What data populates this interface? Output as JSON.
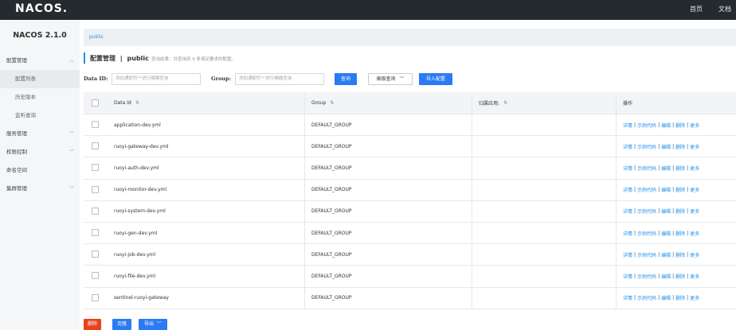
{
  "header": {
    "logo": "NACOS.",
    "nav": [
      "首页",
      "文档"
    ]
  },
  "sidebar": {
    "version": "NACOS 2.1.0",
    "items": [
      {
        "label": "配置管理",
        "chevron": "^"
      },
      {
        "label": "配置列表"
      },
      {
        "label": "历史版本"
      },
      {
        "label": "监听查询"
      },
      {
        "label": "服务管理",
        "chevron": "v"
      },
      {
        "label": "权限控制",
        "chevron": "v"
      },
      {
        "label": "命名空间"
      },
      {
        "label": "集群管理",
        "chevron": "v"
      }
    ]
  },
  "breadcrumb": "public",
  "title": {
    "main": "配置管理",
    "sep": "|",
    "namespace": "public",
    "hint": "查询结果：共查询到 9 条满足要求的配置。"
  },
  "filters": {
    "dataid_label": "Data ID:",
    "dataid_placeholder": "添加通配符'*'进行模糊查询",
    "group_label": "Group:",
    "group_placeholder": "添加通配符'*'进行模糊查询",
    "search_btn": "查询",
    "advanced_btn": "高级查询",
    "import_btn": "导入配置"
  },
  "table": {
    "headers": [
      "Data Id",
      "Group",
      "归属应用:",
      "操作"
    ],
    "sort_icon": "⇅",
    "rows": [
      {
        "dataid": "application-dev.yml",
        "group": "DEFAULT_GROUP",
        "app": ""
      },
      {
        "dataid": "ruoyi-gateway-dev.yml",
        "group": "DEFAULT_GROUP",
        "app": ""
      },
      {
        "dataid": "ruoyi-auth-dev.yml",
        "group": "DEFAULT_GROUP",
        "app": ""
      },
      {
        "dataid": "ruoyi-monitor-dev.yml",
        "group": "DEFAULT_GROUP",
        "app": ""
      },
      {
        "dataid": "ruoyi-system-dev.yml",
        "group": "DEFAULT_GROUP",
        "app": ""
      },
      {
        "dataid": "ruoyi-gen-dev.yml",
        "group": "DEFAULT_GROUP",
        "app": ""
      },
      {
        "dataid": "ruoyi-job-dev.yml",
        "group": "DEFAULT_GROUP",
        "app": ""
      },
      {
        "dataid": "ruoyi-file-dev.yml",
        "group": "DEFAULT_GROUP",
        "app": ""
      },
      {
        "dataid": "sentinel-ruoyi-gateway",
        "group": "DEFAULT_GROUP",
        "app": ""
      }
    ],
    "ops": [
      "详情",
      "示例代码",
      "编辑",
      "删除",
      "更多"
    ],
    "ops_sep": "|"
  },
  "bottom": {
    "delete_btn": "删除",
    "clone_btn": "克隆",
    "export_btn": "导出"
  },
  "colors": {
    "topbar": "#252a2f",
    "accent": "#2a7bf4",
    "link": "#1a8ff0",
    "danger": "#e8421a"
  }
}
